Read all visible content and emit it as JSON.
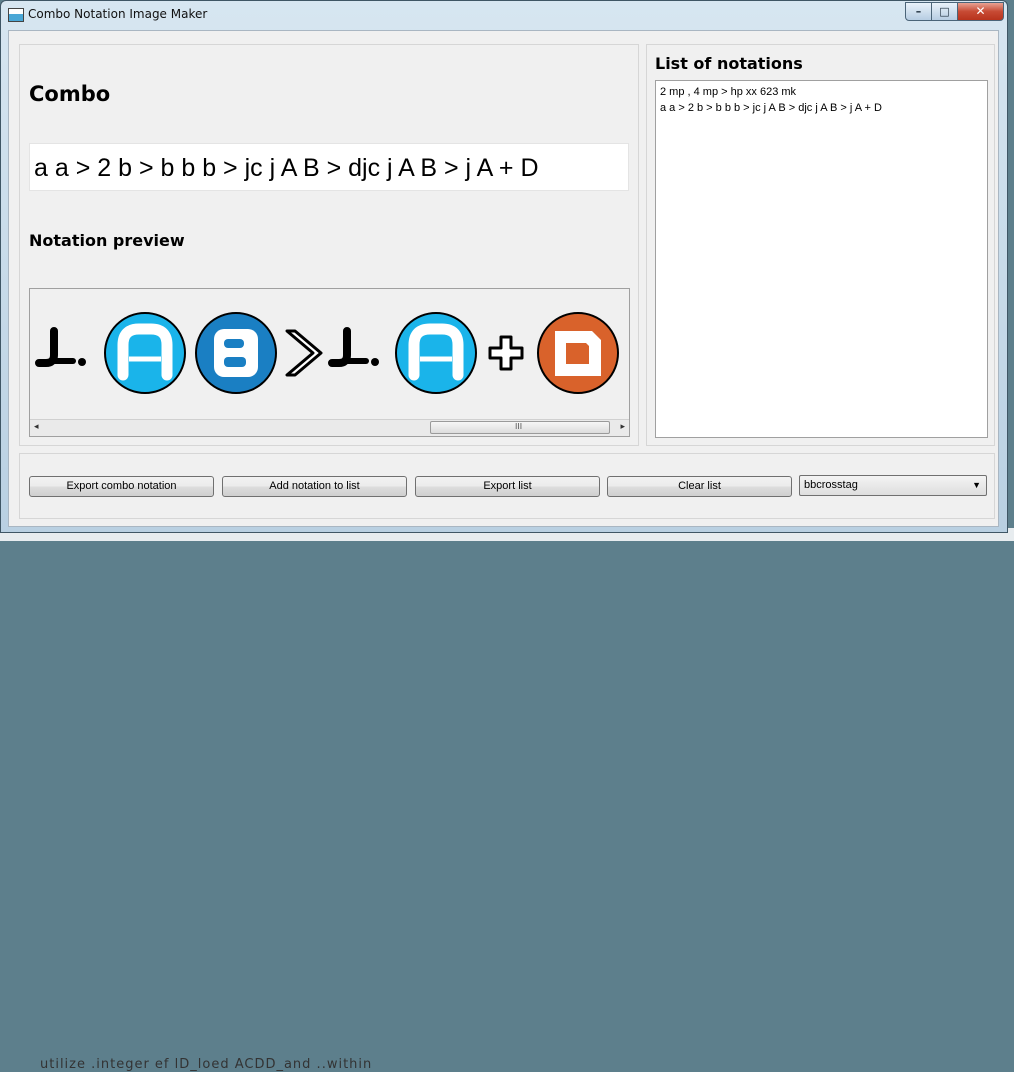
{
  "window": {
    "title": "Combo Notation Image Maker",
    "controls": {
      "minimize": "–",
      "maximize": "□",
      "close": "✕"
    }
  },
  "combo": {
    "heading": "Combo",
    "input_value": "a a > 2 b > b b b > jc j A B > djc j A B > j A + D"
  },
  "preview": {
    "heading": "Notation preview",
    "icons": [
      {
        "name": "jump-arrow-icon",
        "kind": "jump"
      },
      {
        "name": "a-button-icon",
        "kind": "button",
        "letter": "A",
        "fill": "#1ab4ea"
      },
      {
        "name": "b-button-icon",
        "kind": "button",
        "letter": "B",
        "fill": "#1a7fc3"
      },
      {
        "name": "chevron-right-icon",
        "kind": "chevron"
      },
      {
        "name": "jump-arrow-icon",
        "kind": "jump"
      },
      {
        "name": "a-button-icon",
        "kind": "button",
        "letter": "A",
        "fill": "#1ab4ea"
      },
      {
        "name": "plus-icon",
        "kind": "plus"
      },
      {
        "name": "d-button-icon",
        "kind": "button",
        "letter": "D",
        "fill": "#d9622b"
      }
    ],
    "scroll_grip": "III"
  },
  "list": {
    "heading": "List of notations",
    "items": [
      "2 mp , 4 mp > hp xx 623 mk",
      "a a > 2 b > b b b > jc j A B > djc j A B > j A + D"
    ]
  },
  "buttons": {
    "export_combo": "Export combo notation",
    "add_to_list": "Add notation to list",
    "export_list": "Export list",
    "clear_list": "Clear list"
  },
  "style_select": {
    "value": "bbcrosstag"
  },
  "background_text": "utilize .integer ef lD_loed ACDD_and ..within"
}
